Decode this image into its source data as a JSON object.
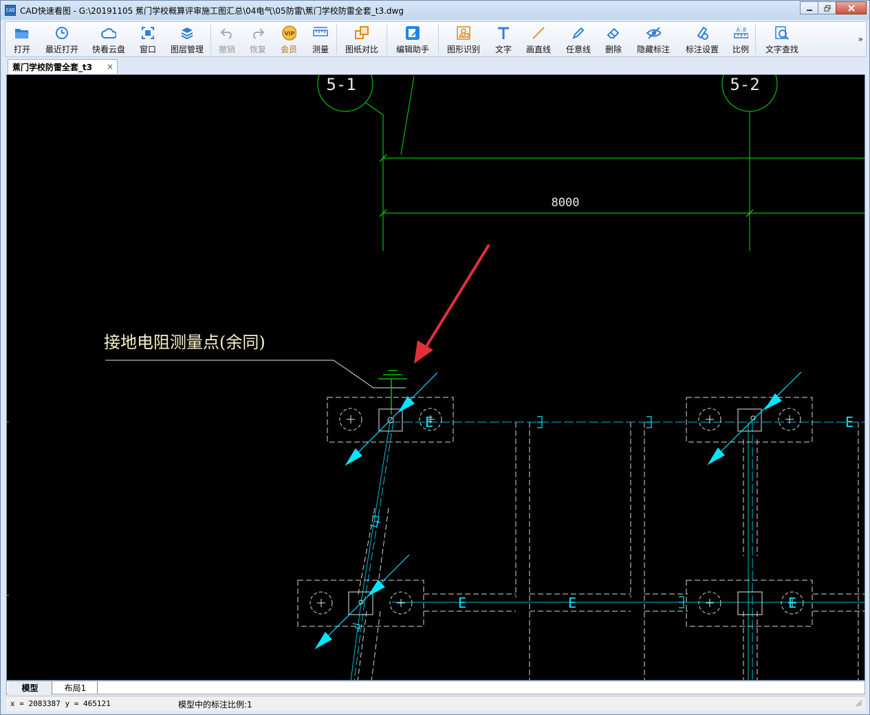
{
  "window": {
    "app_icon_text": "CAD",
    "title": "CAD快速看图 - G:\\20191105 蕉门学校概算评审施工图汇总\\04电气\\05防雷\\蕉门学校防雷全套_t3.dwg"
  },
  "toolbar": {
    "items": [
      {
        "label": "打开",
        "icon": "folder-open-icon"
      },
      {
        "label": "最近打开",
        "icon": "clock-history-icon"
      },
      {
        "label": "快看云盘",
        "icon": "cloud-icon"
      },
      {
        "label": "窗口",
        "icon": "window-frame-icon"
      },
      {
        "label": "图层管理",
        "icon": "layers-icon"
      },
      {
        "label": "撤销",
        "icon": "undo-icon"
      },
      {
        "label": "恢复",
        "icon": "redo-icon"
      },
      {
        "label": "会员",
        "icon": "vip-badge-icon",
        "badge": "VIP"
      },
      {
        "label": "测量",
        "icon": "ruler-icon"
      },
      {
        "label": "图纸对比",
        "icon": "compare-squares-icon"
      },
      {
        "label": "编辑助手",
        "icon": "edit-assistant-icon"
      },
      {
        "label": "图形识别",
        "icon": "shape-recognition-icon"
      },
      {
        "label": "文字",
        "icon": "text-t-icon"
      },
      {
        "label": "画直线",
        "icon": "line-icon"
      },
      {
        "label": "任意线",
        "icon": "pen-icon"
      },
      {
        "label": "删除",
        "icon": "eraser-icon"
      },
      {
        "label": "隐藏标注",
        "icon": "eye-slash-icon"
      },
      {
        "label": "标注设置",
        "icon": "gear-pen-icon"
      },
      {
        "label": "比例",
        "icon": "scale-ab-icon"
      },
      {
        "label": "文字查找",
        "icon": "text-search-icon"
      }
    ],
    "more": "»"
  },
  "tabs": {
    "doc_tab_label": "蕉门学校防雷全套_t3",
    "close": "×"
  },
  "drawing": {
    "axis_left": "5-1",
    "axis_right": "5-2",
    "dimension": "8000",
    "note": "接地电阻测量点(余同)",
    "e_mark": "E",
    "colors": {
      "background": "#000000",
      "axis_green": "#00c000",
      "cyan": "#00e5ff",
      "note_yellow": "#f5f2c8",
      "arrow_red": "#e0303a",
      "dashed": "#d8d8d8"
    }
  },
  "layout_tabs": [
    {
      "label": "模型",
      "active": true
    },
    {
      "label": "布局1",
      "active": false
    }
  ],
  "status": {
    "coords": "x = 2083387  y = 465121",
    "scale_text": "模型中的标注比例:1"
  }
}
